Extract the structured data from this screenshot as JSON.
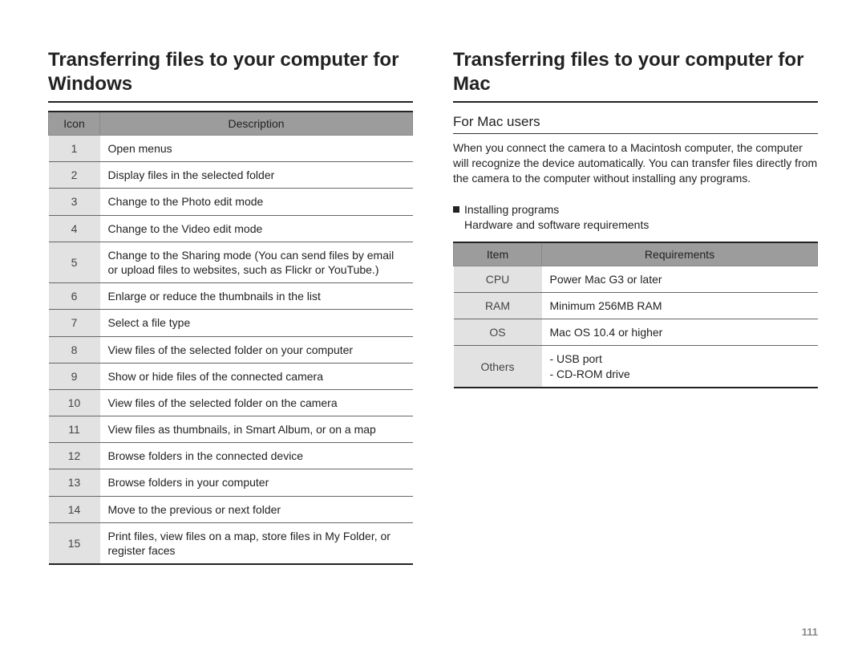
{
  "page_number": "111",
  "left": {
    "title": "Transferring files to your computer for Windows",
    "table": {
      "headers": [
        "Icon",
        "Description"
      ],
      "rows": [
        {
          "icon": "1",
          "desc": "Open menus"
        },
        {
          "icon": "2",
          "desc": "Display files in the selected folder"
        },
        {
          "icon": "3",
          "desc": "Change to the Photo edit mode"
        },
        {
          "icon": "4",
          "desc": "Change to the Video edit mode"
        },
        {
          "icon": "5",
          "desc": "Change to the Sharing mode (You can send files by email or upload files to websites, such as Flickr or YouTube.)"
        },
        {
          "icon": "6",
          "desc": "Enlarge or reduce the thumbnails in the list"
        },
        {
          "icon": "7",
          "desc": "Select a file type"
        },
        {
          "icon": "8",
          "desc": "View files of the selected folder on your computer"
        },
        {
          "icon": "9",
          "desc": "Show or hide files of the connected camera"
        },
        {
          "icon": "10",
          "desc": "View files of the selected folder on the camera"
        },
        {
          "icon": "11",
          "desc": "View files as thumbnails, in Smart Album, or on a map"
        },
        {
          "icon": "12",
          "desc": "Browse folders in the connected device"
        },
        {
          "icon": "13",
          "desc": "Browse folders in your computer"
        },
        {
          "icon": "14",
          "desc": "Move to the previous or next folder"
        },
        {
          "icon": "15",
          "desc": "Print files, view files on a map, store files in My Folder, or register faces"
        }
      ]
    }
  },
  "right": {
    "title": "Transferring files to your computer for Mac",
    "subheading": "For Mac users",
    "paragraph": "When you connect the camera to a Macintosh computer, the computer will recognize the device automatically. You can transfer files directly from the camera to the computer without installing any programs.",
    "bullet_line1": "Installing programs",
    "bullet_line2": "Hardware and software requirements",
    "req_table": {
      "headers": [
        "Item",
        "Requirements"
      ],
      "rows": [
        {
          "item": "CPU",
          "req": "Power Mac G3 or later"
        },
        {
          "item": "RAM",
          "req": "Minimum 256MB RAM"
        },
        {
          "item": "OS",
          "req": "Mac OS 10.4 or higher"
        },
        {
          "item": "Others",
          "req": "- USB port\n- CD-ROM drive"
        }
      ]
    }
  }
}
